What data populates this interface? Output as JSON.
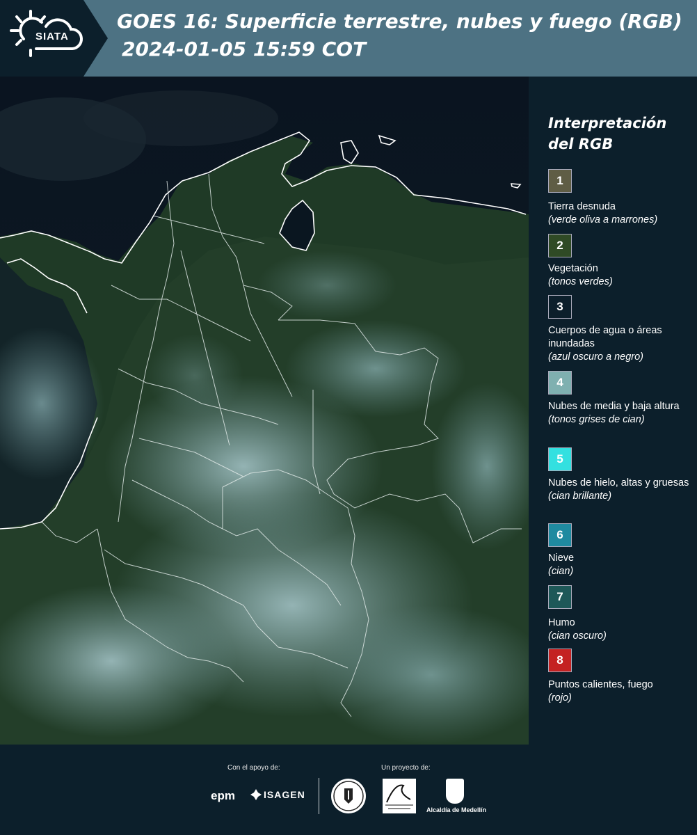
{
  "header": {
    "logo_text": "SIATA",
    "title_line1": "GOES 16: Superficie terrestre, nubes y fuego (RGB)",
    "title_line2": "2024-01-05 15:59 COT"
  },
  "legend": {
    "title_line1": "Interpretación",
    "title_line2": "del RGB",
    "items": [
      {
        "number": "1",
        "label": "Tierra desnuda",
        "note": "(verde oliva a marrones)",
        "color": "#5f5d45"
      },
      {
        "number": "2",
        "label": "Vegetación",
        "note": "(tonos verdes)",
        "color": "#2f4a25"
      },
      {
        "number": "3",
        "label": "Cuerpos de agua o áreas inundadas",
        "note": "(azul oscuro a negro)",
        "color": "#0c1f2b"
      },
      {
        "number": "4",
        "label": "Nubes de media y baja altura",
        "note": "(tonos grises de cian)",
        "color": "#7fb0b0"
      },
      {
        "number": "5",
        "label": "Nubes de hielo, altas y gruesas",
        "note": "(cian brillante)",
        "color": "#33e0e0"
      },
      {
        "number": "6",
        "label": "Nieve",
        "note": "(cian)",
        "color": "#1f8aa0"
      },
      {
        "number": "7",
        "label": "Humo",
        "note": "(cian oscuro)",
        "color": "#1e5858"
      },
      {
        "number": "8",
        "label": "Puntos calientes, fuego",
        "note": "(rojo)",
        "color": "#c42222"
      }
    ]
  },
  "footer": {
    "support_label": "Con el apoyo de:",
    "project_label": "Un proyecto de:",
    "epm": "epm",
    "isagen": "ISAGEN",
    "alcaldia": "Alcaldía de Medellín"
  },
  "colors": {
    "header_bg": "#4d7283",
    "page_bg": "#0c1f2b"
  }
}
